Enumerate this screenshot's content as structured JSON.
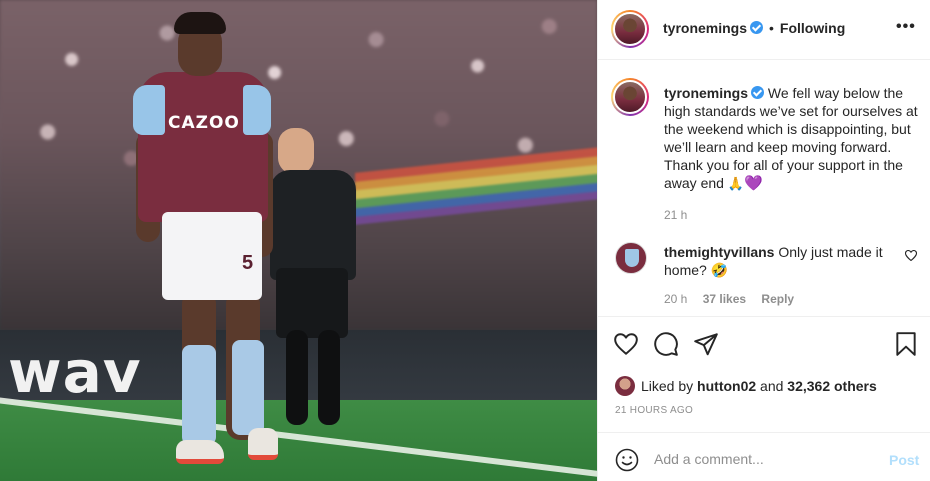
{
  "header": {
    "username": "tyronemings",
    "verified": true,
    "separator": "•",
    "follow_status": "Following",
    "more_icon": "more-options-icon"
  },
  "photo": {
    "hoarding_text": "wav",
    "shirt_sponsor": "CAZOO",
    "shorts_number": "5"
  },
  "caption": {
    "username": "tyronemings",
    "text": "We fell way below the high standards we’ve set for ourselves at the weekend which is disappointing, but we’ll learn and keep moving forward. Thank you for all of your support in the away end",
    "emoji_1": "🙏",
    "emoji_2": "💜",
    "time": "21 h"
  },
  "comment": {
    "username": "themightyvillans",
    "text": "Only just made it home?",
    "emoji": "🤣",
    "time": "20 h",
    "likes": "37 likes",
    "reply": "Reply"
  },
  "likes": {
    "prefix": "Liked by",
    "user": "hutton02",
    "connector": "and",
    "others": "32,362 others",
    "posted_ago": "21 HOURS AGO"
  },
  "add_comment": {
    "placeholder": "Add a comment...",
    "post_label": "Post"
  },
  "colors": {
    "verified_blue": "#3897f0",
    "post_disabled": "#b2dffc",
    "muted_text": "#8e8e8e"
  }
}
